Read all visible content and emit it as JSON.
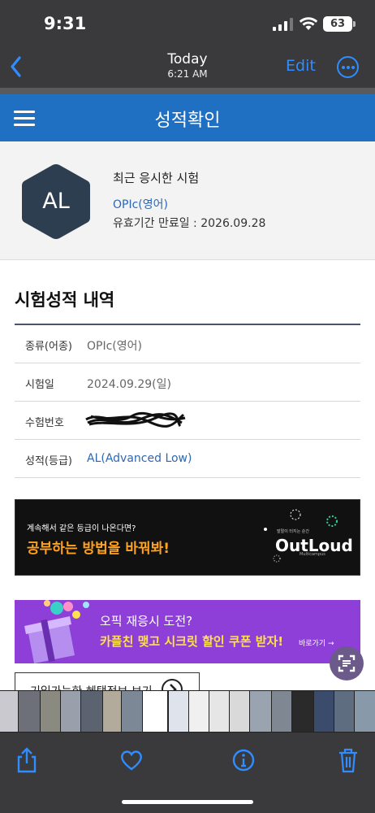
{
  "status_bar": {
    "time": "9:31",
    "battery": "63"
  },
  "photos_nav": {
    "title": "Today",
    "time": "6:21 AM",
    "edit_label": "Edit"
  },
  "page": {
    "title": "성적확인"
  },
  "profile": {
    "grade_badge": "AL",
    "recent_label": "최근 응시한 시험",
    "exam_name": "OPIc(영어)",
    "expiry": "유효기간 만료일 : 2026.09.28"
  },
  "results": {
    "title": "시험성적 내역",
    "rows": [
      {
        "label": "종류(어종)",
        "value": "OPIc(영어)"
      },
      {
        "label": "시험일",
        "value": "2024.09.29(일)"
      },
      {
        "label": "수험번호",
        "value": ""
      },
      {
        "label": "성적(등급)",
        "value": "AL(Advanced Low)"
      }
    ]
  },
  "banner1": {
    "sub": "계속해서 같은 등급이 나온다면?",
    "main": "공부하는 방법을 바꿔봐!",
    "tagline": "발랄이 터지는 순간",
    "logo": "OutLoud",
    "logo_sub": "Multicampus"
  },
  "banner2": {
    "sub": "오픽 재응시 도전?",
    "main": "카플친 맺고 시크릿 할인 쿠폰 받자!",
    "go": "바로가기 →"
  },
  "info_link": {
    "label": "기입가능한 혜택정보 보기"
  },
  "colors": {
    "header_blue": "#1f6fc2",
    "link_blue": "#2e67b3",
    "ios_blue": "#2f8dff",
    "hex_badge": "#2c3e50",
    "banner_orange": "#ffa21f",
    "banner_purple": "#8d3fd8",
    "coupon_yellow": "#ffe14a"
  },
  "icons": {
    "nav_back": "chevron-left-icon",
    "nav_more": "ellipsis-circle-icon",
    "menu": "hamburger-icon",
    "share": "share-icon",
    "favorite": "heart-icon",
    "info": "info-icon",
    "delete": "trash-icon",
    "live_text": "live-text-scan-icon"
  }
}
